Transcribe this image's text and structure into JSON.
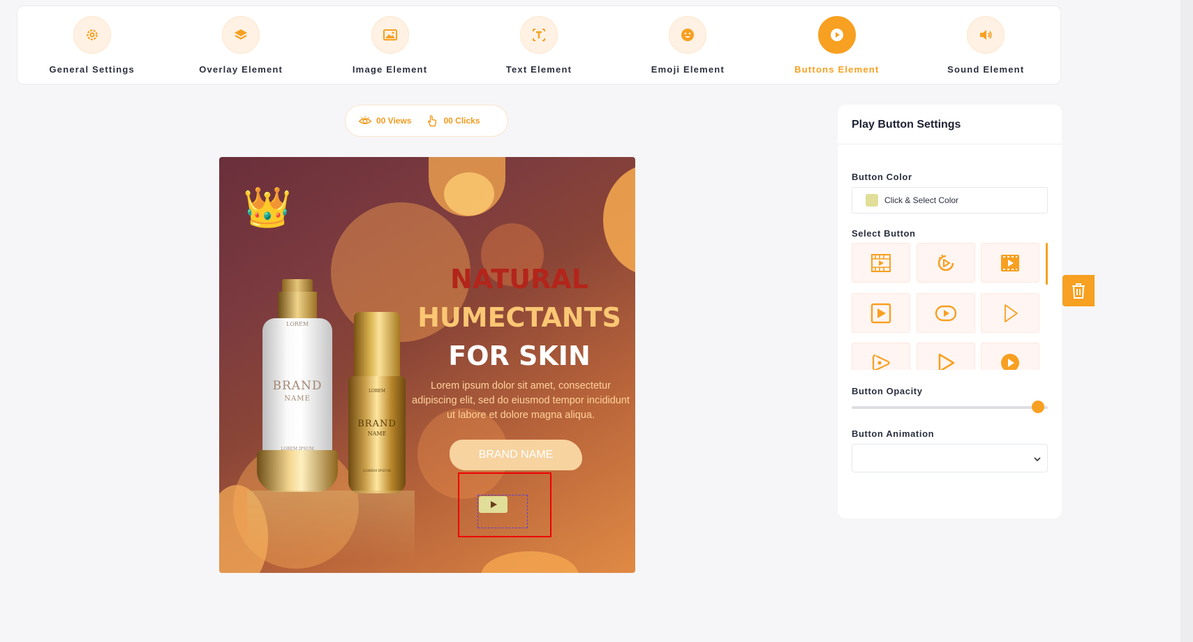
{
  "toolbar": {
    "tabs": [
      {
        "label": "General Settings",
        "icon": "gear-icon"
      },
      {
        "label": "Overlay Element",
        "icon": "layers-icon"
      },
      {
        "label": "Image Element",
        "icon": "image-icon"
      },
      {
        "label": "Text Element",
        "icon": "text-icon"
      },
      {
        "label": "Emoji Element",
        "icon": "smiley-icon"
      },
      {
        "label": "Buttons Element",
        "icon": "play-circle-icon",
        "active": true
      },
      {
        "label": "Sound Element",
        "icon": "speaker-icon"
      }
    ]
  },
  "stats": {
    "views": "00 Views",
    "clicks": "00 Clicks"
  },
  "canvas": {
    "emoji": "👑",
    "headline_1": "NATURAL",
    "headline_2": "HUMECTANTS",
    "headline_3": "FOR SKIN",
    "body": "Lorem ipsum dolor sit amet, consectetur adipiscing elit, sed do eiusmod tempor incididunt ut labore et dolore magna aliqua.",
    "brand_banner": "BRAND NAME",
    "bottle_1": {
      "top": "LOREM",
      "brand": "BRAND",
      "name": "NAME",
      "bottom": "LOREM IPSUM"
    },
    "bottle_2": {
      "top": "LOREM",
      "brand": "BRAND",
      "name": "NAME",
      "bottom": "LOREM IPSUM"
    },
    "play_button_color": "#e0de98"
  },
  "settings": {
    "title": "Play Button Settings",
    "button_color_label": "Button Color",
    "color_placeholder": "Click & Select Color",
    "color_value": "#e0de98",
    "select_button_label": "Select Button",
    "button_styles": [
      "film-play-icon",
      "replay-circle-icon",
      "filmstrip-play-icon",
      "square-play-icon",
      "rounded-play-icon",
      "outline-triangle-icon",
      "dotted-play-icon",
      "triangle-play-icon",
      "filled-circle-play-icon"
    ],
    "opacity_label": "Button Opacity",
    "opacity_value": 0.95,
    "animation_label": "Button Animation",
    "animation_value": ""
  },
  "colors": {
    "accent": "#f7a021",
    "tab_icon_bg": "#fff1e3"
  }
}
